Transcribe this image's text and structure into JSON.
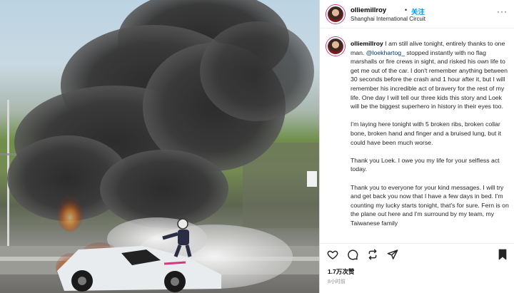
{
  "post": {
    "username": "olliemillroy",
    "dot": "•",
    "follow_label": "关注",
    "location": "Shanghai International Circuit",
    "more_label": "···"
  },
  "caption": {
    "username": "olliemillroy",
    "p1_before": " I am still alive tonight, entirely thanks to one man. ",
    "mention": "@loekhartog_",
    "p1_after": " stopped instantly with no flag marshalls or fire crews in sight, and risked his own life to get me out of the car. I don't remember anything between 30 seconds before the crash and 1 hour after it, but I will remember his incredible act of bravery for the rest of my life. One day I will tell our three kids this story and Loek will be the biggest superhero in history in their eyes too.",
    "p2": "I'm laying here tonight with 5 broken ribs, broken collar bone, broken hand and finger and a bruised lung, but it could have been much worse.",
    "p3": "Thank you Loek. I owe you my life for your selfless act today.",
    "p4": "Thank you to everyone for your kind messages. I will try and get back you now that I have a few days in bed. I'm counting my lucky starts tonight, that's for sure. Fern is on the plane out here and I'm surround by my team, my Taiwanese family"
  },
  "stats": {
    "likes": "1.7万次赞",
    "time_ago": "8小时前"
  },
  "icons": {
    "like": "heart-icon",
    "comment": "comment-icon",
    "repost": "repost-icon",
    "share": "send-icon",
    "save": "bookmark-icon",
    "more": "more-icon"
  },
  "colors": {
    "accent": "#0095f6",
    "mention": "#00376b",
    "muted": "#8e8e8e",
    "fire": "#f07a1a"
  }
}
